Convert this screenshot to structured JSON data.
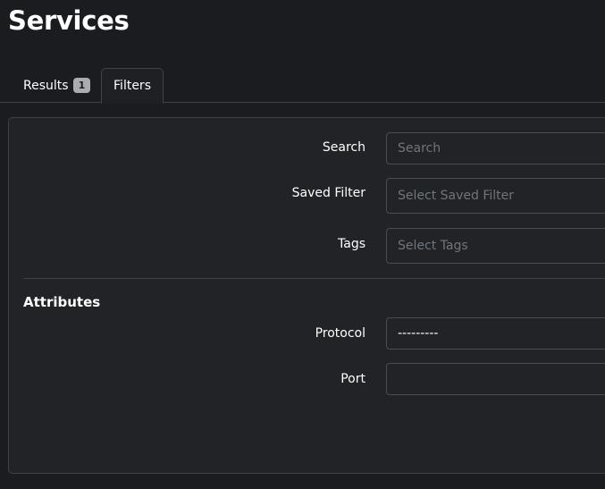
{
  "page": {
    "title": "Services"
  },
  "tabs": [
    {
      "label": "Results",
      "badge": "1"
    },
    {
      "label": "Filters"
    }
  ],
  "filters": {
    "search": {
      "label": "Search",
      "placeholder": "Search"
    },
    "saved_filter": {
      "label": "Saved Filter",
      "placeholder": "Select Saved Filter"
    },
    "tags": {
      "label": "Tags",
      "placeholder": "Select Tags"
    }
  },
  "attributes": {
    "heading": "Attributes",
    "protocol": {
      "label": "Protocol",
      "value": "---------"
    },
    "port": {
      "label": "Port",
      "value": ""
    }
  },
  "colors": {
    "background": "#1a1c1f",
    "panel": "#212327",
    "border": "#3e4349",
    "badge": "#a9adb2"
  }
}
